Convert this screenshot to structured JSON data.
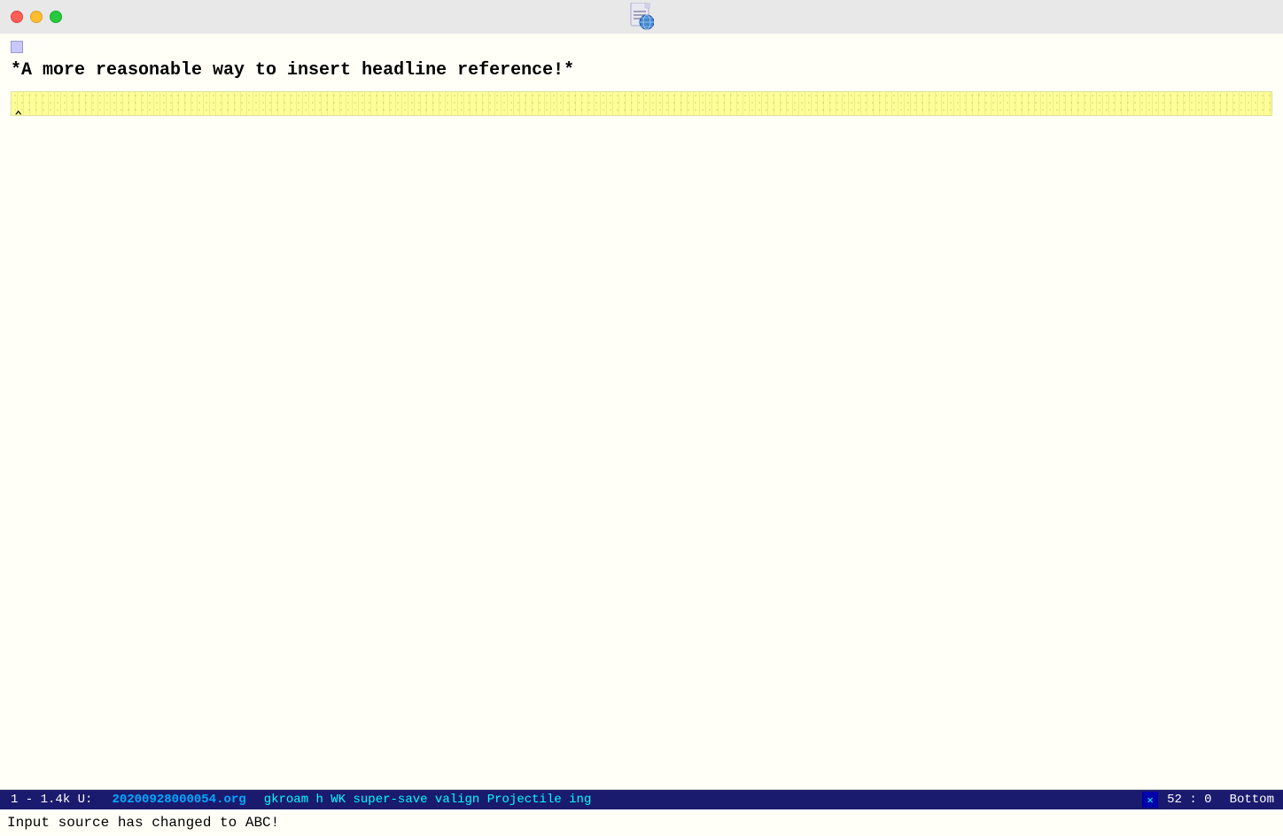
{
  "titlebar": {
    "traffic_lights": {
      "red_label": "close",
      "yellow_label": "minimize",
      "green_label": "maximize"
    }
  },
  "editor": {
    "selection_indicator_visible": true,
    "headline": "*A more reasonable way to insert headline reference!*",
    "cursor_line_content": ""
  },
  "statusbar": {
    "left_number": "1",
    "file_size": "1.4k",
    "mode_prefix": "U:",
    "filename": "20200928000054.org",
    "modes": "gkroam h WK super-save valign Projectile ing",
    "position": "52 : 0",
    "location": "Bottom"
  },
  "minibuffer": {
    "message": "Input source has changed to ABC!"
  }
}
